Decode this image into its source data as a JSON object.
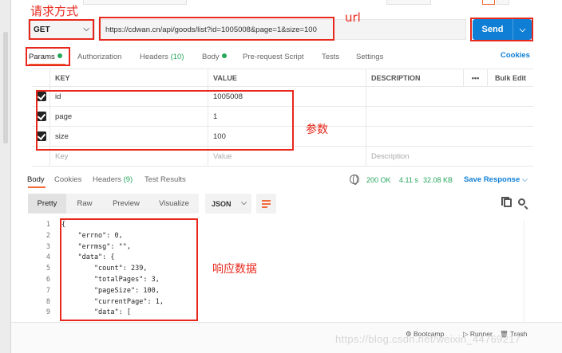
{
  "request": {
    "method": "GET",
    "url": "https://cdwan.cn/api/goods/list?id=1005008&page=1&size=100",
    "send_label": "Send"
  },
  "request_tabs": [
    {
      "label": "Params",
      "active": true,
      "dot": true
    },
    {
      "label": "Authorization"
    },
    {
      "label": "Headers",
      "count": "(10)"
    },
    {
      "label": "Body",
      "dot": true
    },
    {
      "label": "Pre-request Script"
    },
    {
      "label": "Tests"
    },
    {
      "label": "Settings"
    }
  ],
  "cookies_label": "Cookies",
  "params_table": {
    "headers": {
      "key": "KEY",
      "value": "VALUE",
      "description": "DESCRIPTION",
      "more": "•••",
      "bulk_edit": "Bulk Edit"
    },
    "rows": [
      {
        "key": "id",
        "value": "1005008",
        "checked": true
      },
      {
        "key": "page",
        "value": "1",
        "checked": true
      },
      {
        "key": "size",
        "value": "100",
        "checked": true
      }
    ],
    "placeholders": {
      "key": "Key",
      "value": "Value",
      "description": "Description"
    }
  },
  "response_tabs": [
    {
      "label": "Body",
      "active": true
    },
    {
      "label": "Cookies"
    },
    {
      "label": "Headers",
      "count": "(9)"
    },
    {
      "label": "Test Results"
    }
  ],
  "response_status": {
    "status": "200 OK",
    "time": "4.11 s",
    "size": "32.08 KB",
    "save_label": "Save Response"
  },
  "view_modes": [
    "Pretty",
    "Raw",
    "Preview",
    "Visualize"
  ],
  "format_select": "JSON",
  "code_lines": [
    {
      "n": "1",
      "text": "{"
    },
    {
      "n": "2",
      "text": "    \"errno\": 0,"
    },
    {
      "n": "3",
      "text": "    \"errmsg\": \"\","
    },
    {
      "n": "4",
      "text": "    \"data\": {"
    },
    {
      "n": "5",
      "text": "        \"count\": 239,"
    },
    {
      "n": "6",
      "text": "        \"totalPages\": 3,"
    },
    {
      "n": "7",
      "text": "        \"pageSize\": 100,"
    },
    {
      "n": "8",
      "text": "        \"currentPage\": 1,"
    },
    {
      "n": "9",
      "text": "        \"data\": ["
    }
  ],
  "footer": {
    "bootcamp": "Bootcamp",
    "runner": "Runner",
    "trash": "Trash"
  },
  "watermark": "https://blog.csdn.net/weixin_44769217",
  "annotations": {
    "method": "请求方式",
    "url": "url",
    "params": "参数",
    "response": "响应数据"
  },
  "colors": {
    "accent": "#f26b3a",
    "send": "#0f7fd6",
    "annotation": "#e8281c",
    "ok": "#26a65b"
  }
}
